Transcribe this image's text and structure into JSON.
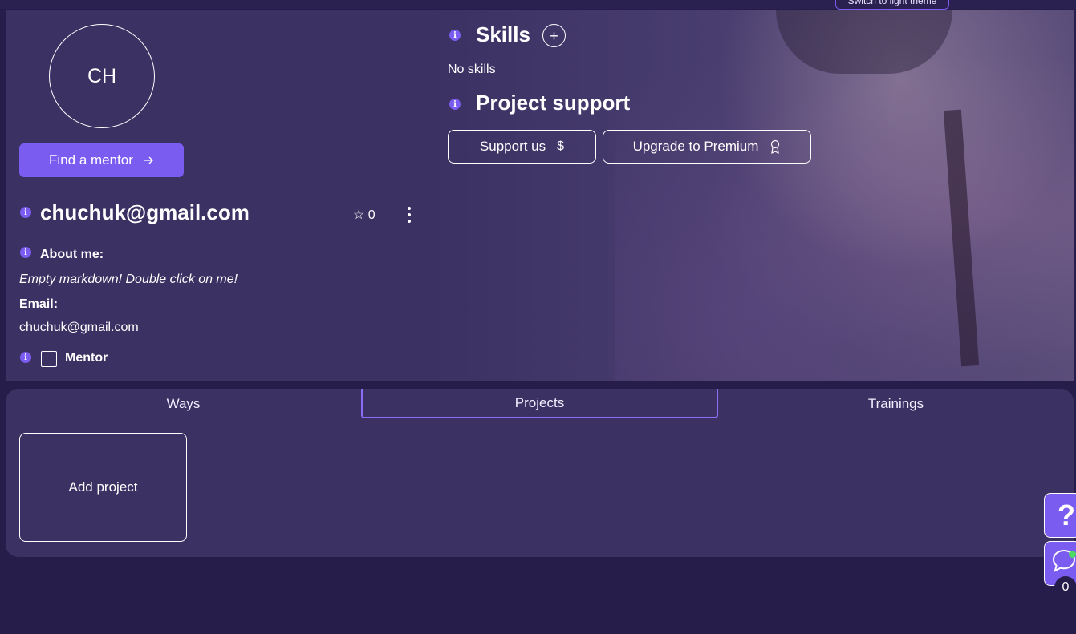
{
  "header": {
    "theme_tooltip": "Switch to light theme"
  },
  "profile": {
    "initials": "CH",
    "find_mentor_label": "Find a mentor",
    "name": "chuchuk@gmail.com",
    "star_count": "0",
    "about_label": "About me:",
    "about_text": "Empty markdown! Double click on me!",
    "email_label": "Email:",
    "email_value": "chuchuk@gmail.com",
    "mentor_label": "Mentor",
    "mentor_checked": false
  },
  "skills": {
    "title": "Skills",
    "empty_text": "No skills"
  },
  "project_support": {
    "title": "Project support",
    "support_label": "Support us",
    "premium_label": "Upgrade to Premium"
  },
  "tabs": [
    {
      "label": "Ways"
    },
    {
      "label": "Projects",
      "active": true
    },
    {
      "label": "Trainings"
    }
  ],
  "projects": {
    "add_label": "Add project"
  },
  "floating": {
    "help_glyph": "?",
    "chat_count": "0"
  },
  "colors": {
    "background": "#261d4a",
    "card": "#3b3163",
    "accent": "#7b5cf0",
    "online": "#4cd964"
  }
}
